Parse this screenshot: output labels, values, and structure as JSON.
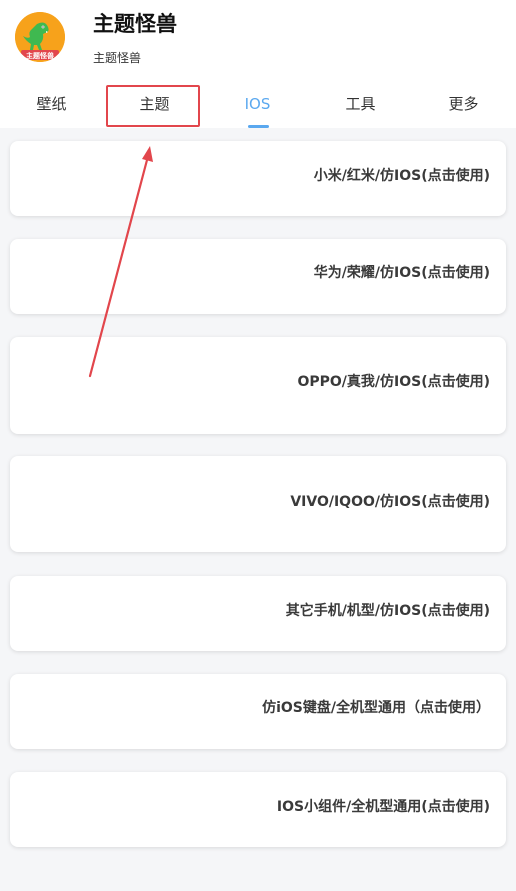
{
  "app": {
    "title": "主题怪兽",
    "subtitle": "主题怪兽",
    "logo_text": "主题怪兽"
  },
  "tabs": [
    {
      "label": "壁纸"
    },
    {
      "label": "主题"
    },
    {
      "label": "IOS"
    },
    {
      "label": "工具"
    },
    {
      "label": "更多"
    }
  ],
  "active_tab": "IOS",
  "cards": [
    {
      "label": "小米/红米/仿IOS(点击使用)"
    },
    {
      "label": "华为/荣耀/仿IOS(点击使用)"
    },
    {
      "label": "OPPO/真我/仿IOS(点击使用)"
    },
    {
      "label": "VIVO/IQOO/仿IOS(点击使用)"
    },
    {
      "label": "其它手机/机型/仿IOS(点击使用)"
    },
    {
      "label": "仿iOS键盘/全机型通用（点击使用）"
    },
    {
      "label": "IOS小组件/全机型通用(点击使用)"
    }
  ],
  "colors": {
    "accent": "#5aa8ef",
    "annotation": "#e2464c",
    "logo_background": "#f7a21b"
  }
}
